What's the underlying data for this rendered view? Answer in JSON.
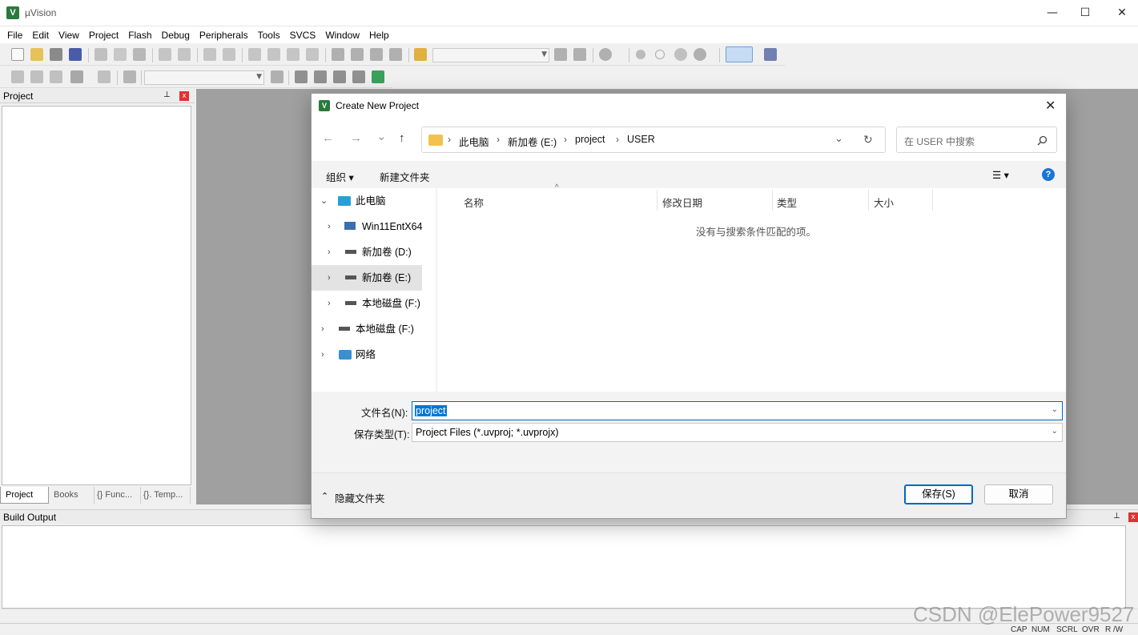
{
  "app": {
    "title": "µVision",
    "icon_letter": "V"
  },
  "window_controls": {
    "minimize": "—",
    "maximize": "☐",
    "close": "✕"
  },
  "menu": [
    "File",
    "Edit",
    "View",
    "Project",
    "Flash",
    "Debug",
    "Peripherals",
    "Tools",
    "SVCS",
    "Window",
    "Help"
  ],
  "project_panel": {
    "title": "Project",
    "pin": "⊥",
    "close": "x",
    "tabs": [
      {
        "label": "Project",
        "icon": "project-tab-icon"
      },
      {
        "label": "Books",
        "icon": "books-icon"
      },
      {
        "label": "{} Func...",
        "icon": "functions-icon"
      },
      {
        "label": "{}. Temp...",
        "icon": "templates-icon"
      }
    ]
  },
  "build_output": {
    "title": "Build Output"
  },
  "status": {
    "cap": "CAP",
    "num": "NUM",
    "scrl": "SCRL",
    "ovr": "OVR",
    "rw": "R /W"
  },
  "watermark": "CSDN @ElePower9527",
  "dialog": {
    "title": "Create New Project",
    "close": "✕",
    "icon_letter": "V",
    "nav": {
      "back": "←",
      "forward": "→",
      "recent": "⌄",
      "up": "↑",
      "refresh": "↻",
      "dropdown": "⌄"
    },
    "breadcrumbs": [
      "此电脑",
      "新加卷 (E:)",
      "project",
      "USER"
    ],
    "search_placeholder": "在 USER 中搜索",
    "commands": {
      "organize": "组织 ▾",
      "new_folder": "新建文件夹",
      "view": "☰ ▾",
      "help": "?"
    },
    "tree": [
      {
        "label": "此电脑",
        "expanded": true,
        "icon": "pc-icon"
      },
      {
        "label": "Win11EntX64",
        "icon": "network-drive-icon"
      },
      {
        "label": "新加卷 (D:)",
        "icon": "drive-icon"
      },
      {
        "label": "新加卷 (E:)",
        "icon": "drive-icon",
        "selected": true
      },
      {
        "label": "本地磁盘 (F:)",
        "icon": "drive-icon"
      },
      {
        "label": "本地磁盘 (F:)",
        "icon": "drive-icon"
      },
      {
        "label": "网络",
        "icon": "network-icon"
      }
    ],
    "columns": [
      "名称",
      "修改日期",
      "类型",
      "大小"
    ],
    "empty_message": "没有与搜索条件匹配的项。",
    "filename_label": "文件名(N):",
    "filename_value": "project",
    "filetype_label": "保存类型(T):",
    "filetype_value": "Project Files (*.uvproj; *.uvprojx)",
    "hide_folders": "隐藏文件夹",
    "save": "保存(S)",
    "cancel": "取消"
  }
}
